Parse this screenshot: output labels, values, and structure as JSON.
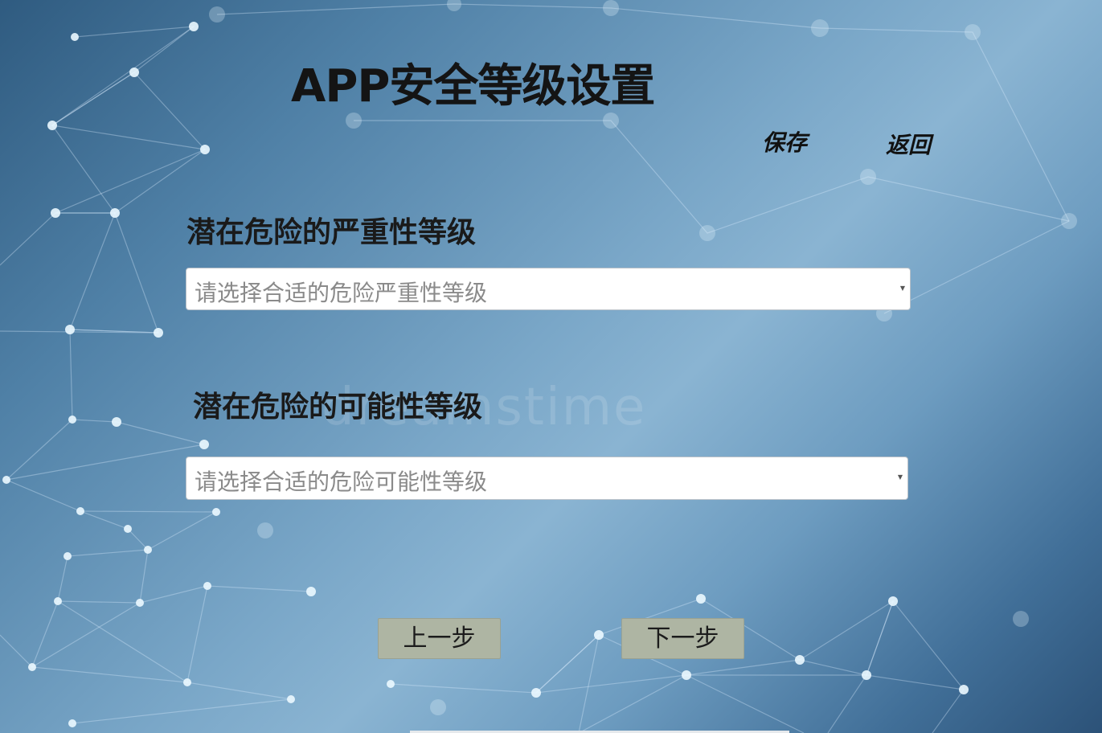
{
  "header": {
    "title": "APP安全等级设置",
    "save_label": "保存",
    "back_label": "返回"
  },
  "severity": {
    "label": "潜在危险的严重性等级",
    "placeholder": "请选择合适的危险严重性等级"
  },
  "likelihood": {
    "label": "潜在危险的可能性等级",
    "placeholder": "请选择合适的危险可能性等级"
  },
  "nav": {
    "prev_label": "上一步",
    "next_label": "下一步"
  },
  "background": {
    "watermark": "dreamstime"
  },
  "colors": {
    "button_bg": "#aeb5a3",
    "title_text": "#141414",
    "placeholder_text": "#8a8a8a"
  },
  "icons": {
    "select_arrow": "chevron-down-icon"
  }
}
